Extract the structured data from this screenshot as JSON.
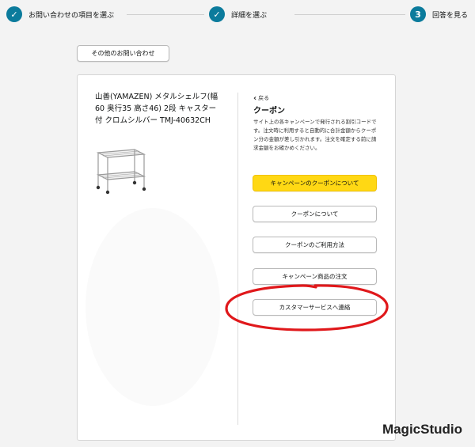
{
  "stepper": {
    "steps": [
      {
        "marker": "✓",
        "label": "お問い合わせの項目を選ぶ"
      },
      {
        "marker": "✓",
        "label": "詳細を選ぶ"
      },
      {
        "marker": "3",
        "label": "回答を見る"
      }
    ]
  },
  "other_inquiry_label": "その他のお問い合わせ",
  "product": {
    "title": "山善(YAMAZEN) メタルシェルフ(幅60 奥行35 高さ46) 2段 キャスター付 クロムシルバー TMJ-40632CH"
  },
  "panel": {
    "back_label": "戻る",
    "title": "クーポン",
    "description": "サイト上の各キャンペーンで発行される割引コードです。注文時に利用すると自動的に合計金額からクーポン分の金額が差し引かれます。注文を確定する前に請求金額をお確かめください。",
    "options": [
      {
        "label": "キャンペーンのクーポンについて",
        "style": "primary"
      },
      {
        "label": "クーポンについて",
        "style": "default"
      },
      {
        "label": "クーポンのご利用方法",
        "style": "default"
      },
      {
        "label": "キャンペーン商品の注文",
        "style": "default"
      },
      {
        "label": "カスタマーサービスへ連絡",
        "style": "default"
      }
    ]
  },
  "annotation_color": "#e0181b",
  "watermark": "MagicStudio"
}
